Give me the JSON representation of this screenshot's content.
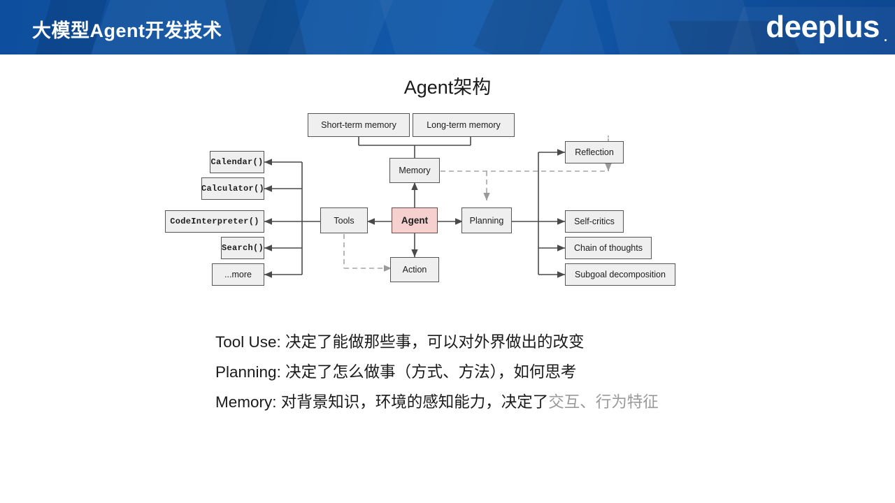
{
  "header": {
    "title": "大模型Agent开发技术",
    "logo": "deeplus",
    "bg_color": "#11549f"
  },
  "slide": {
    "title": "Agent架构"
  },
  "diagram": {
    "title": "Agent架构",
    "accent_agent_color": "#f6cfcf",
    "node_fill": "#efefef",
    "node_stroke": "#555555",
    "nodes": {
      "short_term_memory": "Short-term memory",
      "long_term_memory": "Long-term memory",
      "memory": "Memory",
      "agent": "Agent",
      "tools": "Tools",
      "planning": "Planning",
      "action": "Action",
      "calendar": "Calendar()",
      "calculator": "Calculator()",
      "code_interpreter": "CodeInterpreter()",
      "search": "Search()",
      "more": "...more",
      "reflection": "Reflection",
      "self_critics": "Self-critics",
      "chain_of_thoughts": "Chain of thoughts",
      "subgoal_decomposition": "Subgoal decomposition"
    }
  },
  "bullets": [
    {
      "lead": "Tool Use:",
      "text": "  决定了能做那些事，可以对外界做出的改变",
      "faded": ""
    },
    {
      "lead": "Planning:",
      "text": "  决定了怎么做事（方式、方法），如何思考",
      "faded": ""
    },
    {
      "lead": "Memory:",
      "text": "  对背景知识，环境的感知能力，决定了",
      "faded": "交互、行为特征"
    }
  ]
}
